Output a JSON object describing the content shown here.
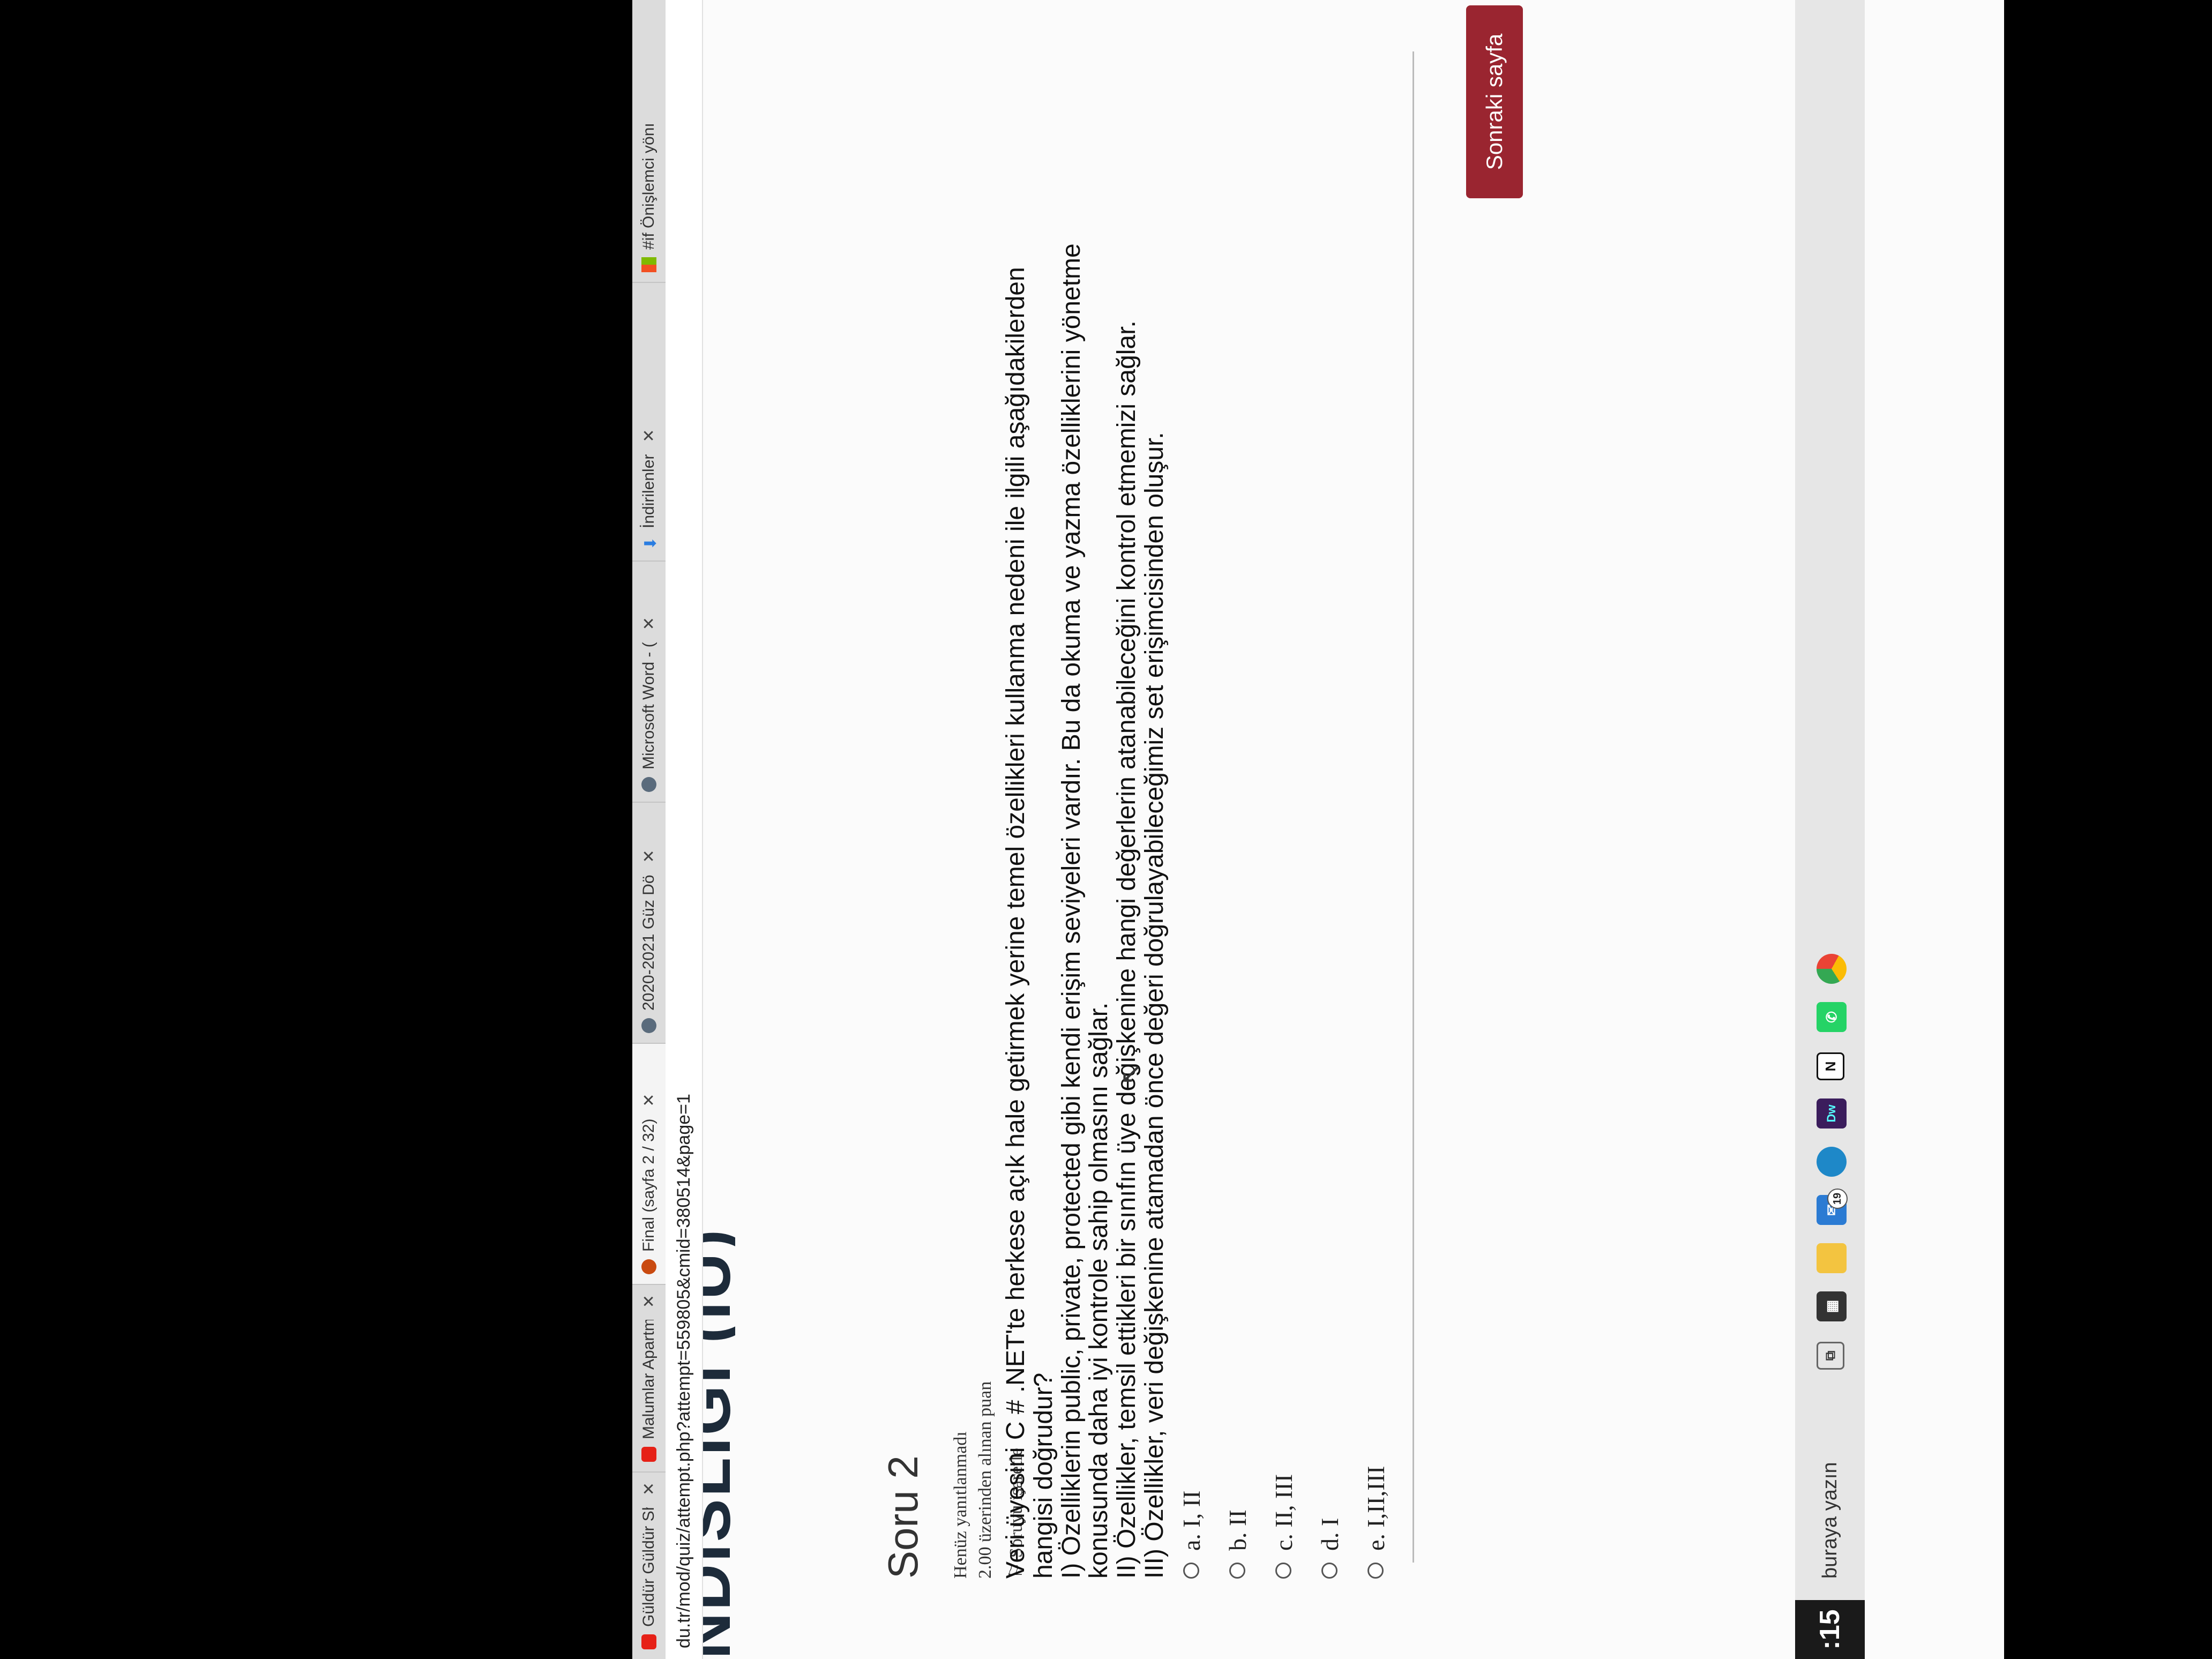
{
  "browser": {
    "tabs": [
      {
        "label": "Güldür Güldür Sh",
        "icon": "youtube-icon",
        "color": "#e62117"
      },
      {
        "label": "Malumlar Apartma",
        "icon": "youtube-icon",
        "color": "#e62117"
      },
      {
        "label": "Final (sayfa 2 / 32)",
        "icon": "moodle-icon",
        "color": "#c94a10"
      },
      {
        "label": "2020-2021 Güz Dö",
        "icon": "globe-icon",
        "color": "#5a6b7c"
      },
      {
        "label": "Microsoft Word - (",
        "icon": "globe-icon",
        "color": "#5a6b7c"
      },
      {
        "label": "İndirilenler",
        "icon": "download-icon",
        "color": "#2a7de1"
      },
      {
        "label": "#if Önişlemci yönı",
        "icon": "microsoft-icon",
        "color": "#f25022"
      }
    ],
    "url": "du.tr/mod/quiz/attempt.php?attempt=559805&cmid=380514&page=1"
  },
  "page": {
    "banner_text": "NDISLIGI (IU)",
    "question": {
      "title": "Soru 2",
      "status": "Henüz yanıtlanmadı",
      "points": "2.00 üzerinden alınan puan",
      "flag_label": "Soruyu işaretle",
      "text_lines": [
        "Veri üyesini C # .NET'te herkese açık hale getirmek yerine temel özellikleri kullanma nedeni ile ilgili aşağıdakilerden",
        "hangisi doğrudur?",
        "I) Özelliklerin public, private, protected gibi kendi erişim seviyeleri vardır. Bu da okuma ve yazma özelliklerini yönetme",
        "konusunda daha iyi kontrole sahip olmasını sağlar.",
        "II) Özellikler, temsil ettikleri bir sınıfın üye değişkenine hangi değerlerin atanabileceğini kontrol etmemizi sağlar.",
        "III) Özellikler, veri değişkenine atamadan önce değeri doğrulayabileceğimiz set erişimcisinden oluşur."
      ],
      "answers": [
        "a. I, II",
        "b. II",
        "c. II, III",
        "d. I",
        "e. I,II,III"
      ]
    },
    "next_button": "Sonraki sayfa",
    "accent": "#9a2530"
  },
  "taskbar": {
    "clock": ":15",
    "search_placeholder": "buraya yazın",
    "mail_badge": "19",
    "apps": [
      "task-view-icon",
      "store-icon",
      "file-explorer-icon",
      "mail-icon",
      "edge-icon",
      "dreamweaver-icon",
      "notion-icon",
      "whatsapp-icon",
      "chrome-icon"
    ]
  }
}
